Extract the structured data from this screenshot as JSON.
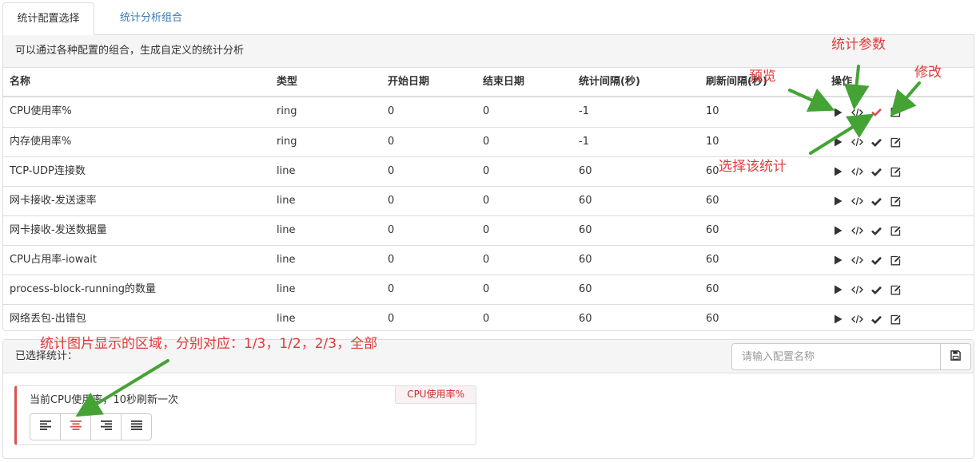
{
  "tabs": [
    {
      "label": "统计配置选择",
      "active": true
    },
    {
      "label": "统计分析组合",
      "active": false
    }
  ],
  "panel": {
    "heading": "可以通过各种配置的组合，生成自定义的统计分析"
  },
  "table": {
    "headers": [
      "名称",
      "类型",
      "开始日期",
      "结束日期",
      "统计间隔(秒)",
      "刷新间隔(秒)",
      "操作"
    ],
    "rows": [
      [
        "CPU使用率%",
        "ring",
        "0",
        "0",
        "-1",
        "10"
      ],
      [
        "内存使用率%",
        "ring",
        "0",
        "0",
        "-1",
        "10"
      ],
      [
        "TCP-UDP连接数",
        "line",
        "0",
        "0",
        "60",
        "60"
      ],
      [
        "网卡接收-发送速率",
        "line",
        "0",
        "0",
        "60",
        "60"
      ],
      [
        "网卡接收-发送数据量",
        "line",
        "0",
        "0",
        "60",
        "60"
      ],
      [
        "CPU占用率-iowait",
        "line",
        "0",
        "0",
        "60",
        "60"
      ],
      [
        "process-block-running的数量",
        "line",
        "0",
        "0",
        "60",
        "60"
      ],
      [
        "网络丢包-出错包",
        "line",
        "0",
        "0",
        "60",
        "60"
      ]
    ],
    "selected_row_index": 0,
    "op_icons": [
      "play-icon",
      "code-icon",
      "check-icon",
      "edit-icon"
    ]
  },
  "selection": {
    "label": "已选择统计：",
    "search_placeholder": "请输入配置名称",
    "card": {
      "description": "当前CPU使用率，10秒刷新一次",
      "badge": "CPU使用率%",
      "align_icons": [
        "align-left-icon",
        "align-center-icon",
        "align-right-icon",
        "align-justify-icon"
      ],
      "active_align_index": 1
    }
  },
  "annotations": {
    "stats_params": "统计参数",
    "preview": "预览",
    "modify": "修改",
    "select_stat": "选择该统计",
    "region": "统计图片显示的区域，分别对应：1/3，1/2，2/3，全部"
  },
  "colors": {
    "accent_red": "#d9534f",
    "annotation_red": "#e03a3a",
    "arrow_green": "#45a336",
    "link_blue": "#337ab7"
  }
}
